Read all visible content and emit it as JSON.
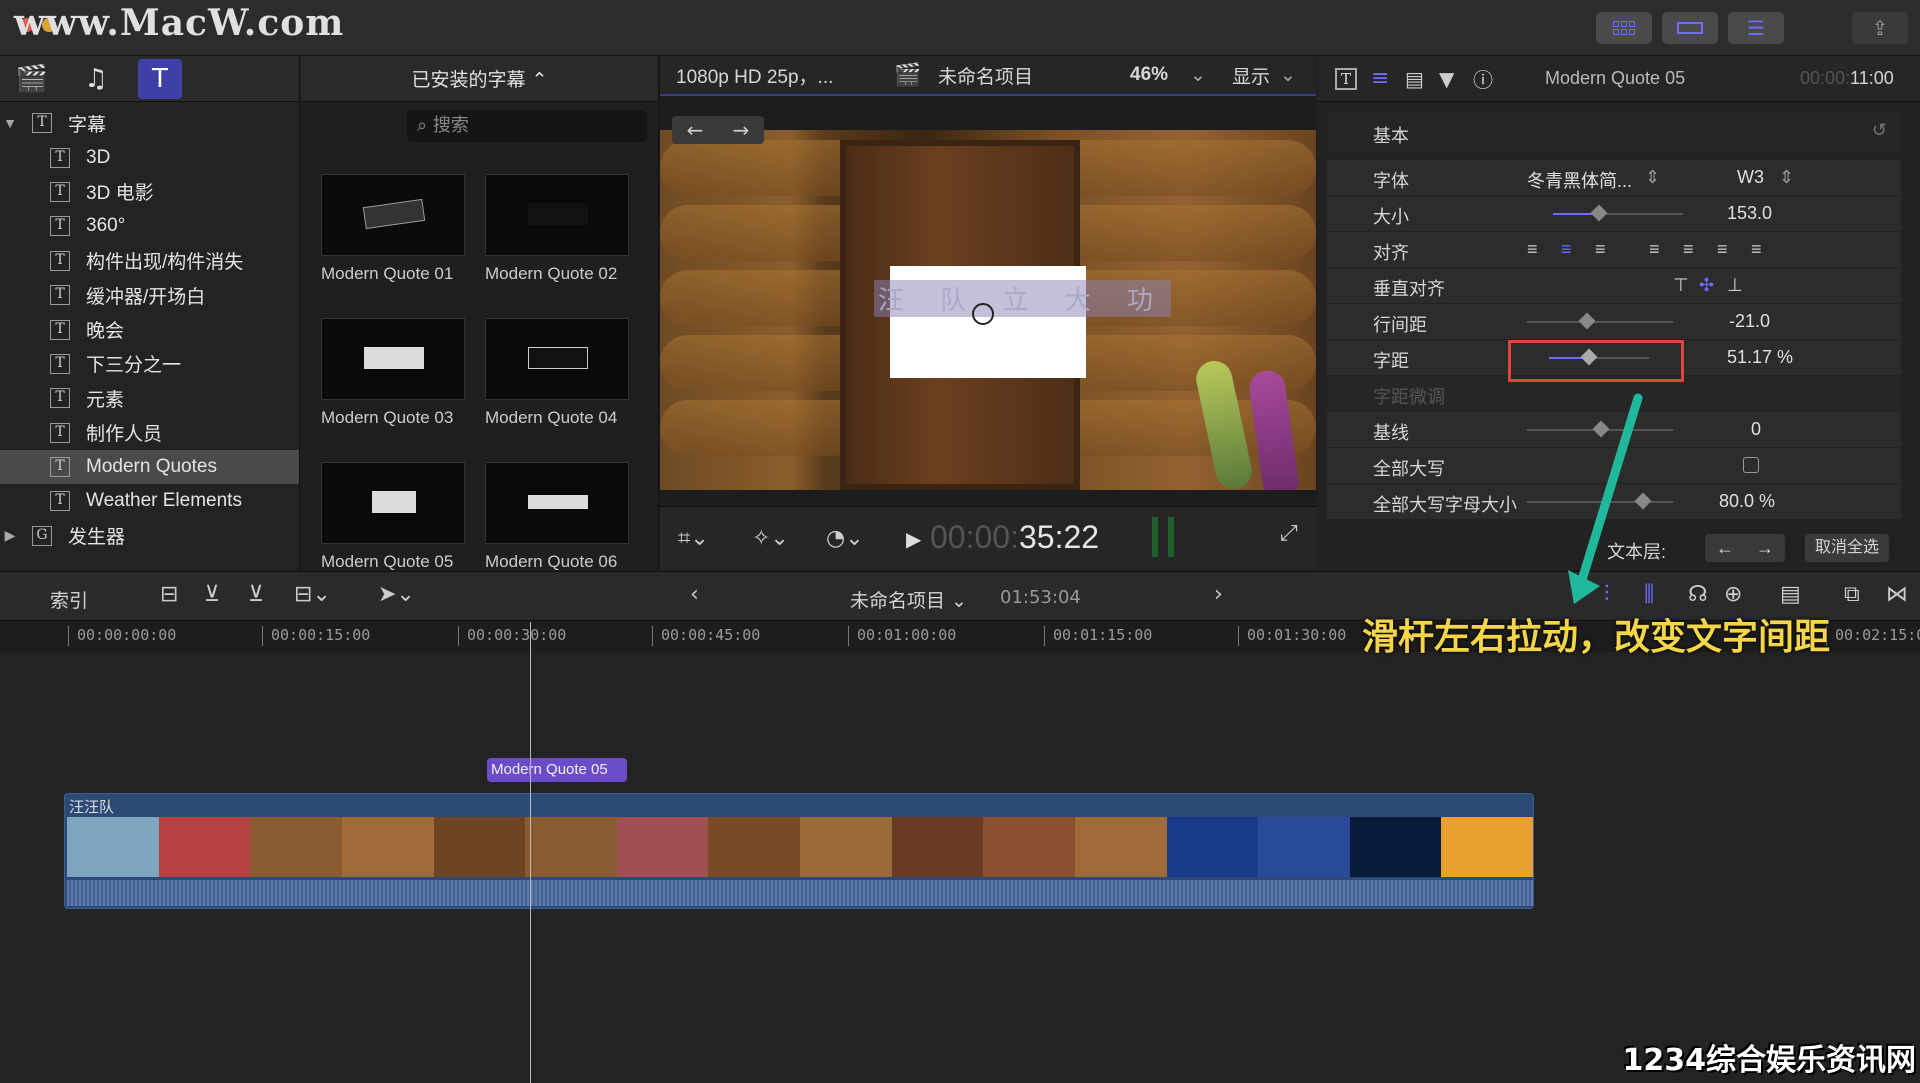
{
  "watermark_top": "www.MacW.com",
  "watermark_bottom": "1234综合娱乐资讯网",
  "library": {
    "header": "已安装的字幕 ⌃",
    "search_placeholder": "搜索",
    "tree": [
      {
        "label": "字幕",
        "expanded": true,
        "level": 0
      },
      {
        "label": "3D",
        "level": 1
      },
      {
        "label": "3D 电影",
        "level": 1
      },
      {
        "label": "360°",
        "level": 1
      },
      {
        "label": "构件出现/构件消失",
        "level": 1
      },
      {
        "label": "缓冲器/开场白",
        "level": 1
      },
      {
        "label": "晚会",
        "level": 1
      },
      {
        "label": "下三分之一",
        "level": 1
      },
      {
        "label": "元素",
        "level": 1
      },
      {
        "label": "制作人员",
        "level": 1
      },
      {
        "label": "Modern Quotes",
        "level": 1,
        "selected": true
      },
      {
        "label": "Weather Elements",
        "level": 1
      },
      {
        "label": "发生器",
        "level": 0,
        "expanded": false
      }
    ],
    "thumbnails": [
      "Modern Quote 01",
      "Modern Quote 02",
      "Modern Quote 03",
      "Modern Quote 04",
      "Modern Quote 05",
      "Modern Quote 06"
    ]
  },
  "viewer": {
    "format": "1080p HD 25p，...",
    "project": "未命名项目",
    "zoom": "46%",
    "display": "显示",
    "timecode_dim": "00:00:",
    "timecode": "35:22",
    "title_text": "汪 队 立 大 功"
  },
  "inspector": {
    "title": "Modern Quote 05",
    "duration_dim": "00:00:",
    "duration": "11:00",
    "section": "基本",
    "rows": [
      {
        "label": "字体",
        "value": "冬青黑体简...",
        "value2": "W3"
      },
      {
        "label": "大小",
        "value": "153.0"
      },
      {
        "label": "对齐",
        "value": ""
      },
      {
        "label": "垂直对齐",
        "value": ""
      },
      {
        "label": "行间距",
        "value": "-21.0"
      },
      {
        "label": "字距",
        "value": "51.17 %"
      },
      {
        "label": "字距微调",
        "value": ""
      },
      {
        "label": "基线",
        "value": "0"
      },
      {
        "label": "全部大写",
        "value": ""
      },
      {
        "label": "全部大写字母大小",
        "value": "80.0 %"
      }
    ],
    "text_layer": "文本层:",
    "deselect_all": "取消全选"
  },
  "timeline": {
    "index": "索引",
    "project": "未命名项目 ⌄",
    "duration": "01:53:04",
    "ruler": [
      "00:00:00:00",
      "00:00:15:00",
      "00:00:30:00",
      "00:00:45:00",
      "00:01:00:00",
      "00:01:15:00",
      "00:01:30:00",
      "00:02:15:0"
    ],
    "title_clip": "Modern Quote 05",
    "video_clip": "汪汪队"
  },
  "callout": "滑杆左右拉动，改变文字间距",
  "colors": {
    "accent": "#6c6cff",
    "highlight": "#e0463c",
    "callout": "#f5d54a",
    "clip": "#2d4a77"
  }
}
